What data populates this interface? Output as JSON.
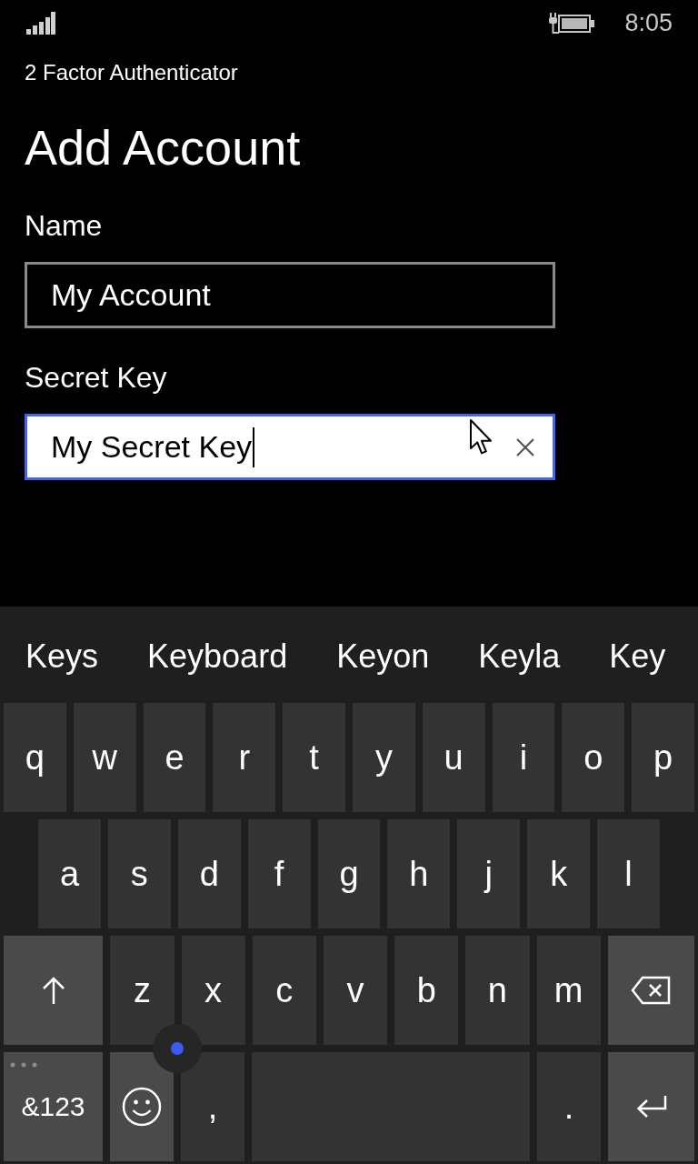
{
  "status_bar": {
    "time": "8:05"
  },
  "app": {
    "title": "2 Factor Authenticator"
  },
  "page": {
    "title": "Add Account"
  },
  "fields": [
    {
      "label": "Name",
      "value": "My Account",
      "focused": false
    },
    {
      "label": "Secret Key",
      "value": "My Secret Key",
      "focused": true
    }
  ],
  "keyboard": {
    "suggestions": [
      "Keys",
      "Keyboard",
      "Keyon",
      "Keyla",
      "Key"
    ],
    "rows": [
      [
        {
          "kind": "char",
          "label": "q"
        },
        {
          "kind": "char",
          "label": "w"
        },
        {
          "kind": "char",
          "label": "e"
        },
        {
          "kind": "char",
          "label": "r"
        },
        {
          "kind": "char",
          "label": "t"
        },
        {
          "kind": "char",
          "label": "y"
        },
        {
          "kind": "char",
          "label": "u"
        },
        {
          "kind": "char",
          "label": "i"
        },
        {
          "kind": "char",
          "label": "o"
        },
        {
          "kind": "char",
          "label": "p"
        }
      ],
      [
        {
          "kind": "char",
          "label": "a"
        },
        {
          "kind": "char",
          "label": "s"
        },
        {
          "kind": "char",
          "label": "d"
        },
        {
          "kind": "char",
          "label": "f"
        },
        {
          "kind": "char",
          "label": "g"
        },
        {
          "kind": "char",
          "label": "h"
        },
        {
          "kind": "char",
          "label": "j"
        },
        {
          "kind": "char",
          "label": "k"
        },
        {
          "kind": "char",
          "label": "l"
        }
      ],
      [
        {
          "kind": "shift"
        },
        {
          "kind": "char",
          "label": "z"
        },
        {
          "kind": "char",
          "label": "x"
        },
        {
          "kind": "char",
          "label": "c"
        },
        {
          "kind": "char",
          "label": "v"
        },
        {
          "kind": "char",
          "label": "b"
        },
        {
          "kind": "char",
          "label": "n"
        },
        {
          "kind": "char",
          "label": "m"
        },
        {
          "kind": "backspace"
        }
      ],
      [
        {
          "kind": "symbols",
          "label": "&123"
        },
        {
          "kind": "emoji"
        },
        {
          "kind": "char",
          "label": ","
        },
        {
          "kind": "space"
        },
        {
          "kind": "char",
          "label": "."
        },
        {
          "kind": "enter"
        }
      ]
    ]
  }
}
